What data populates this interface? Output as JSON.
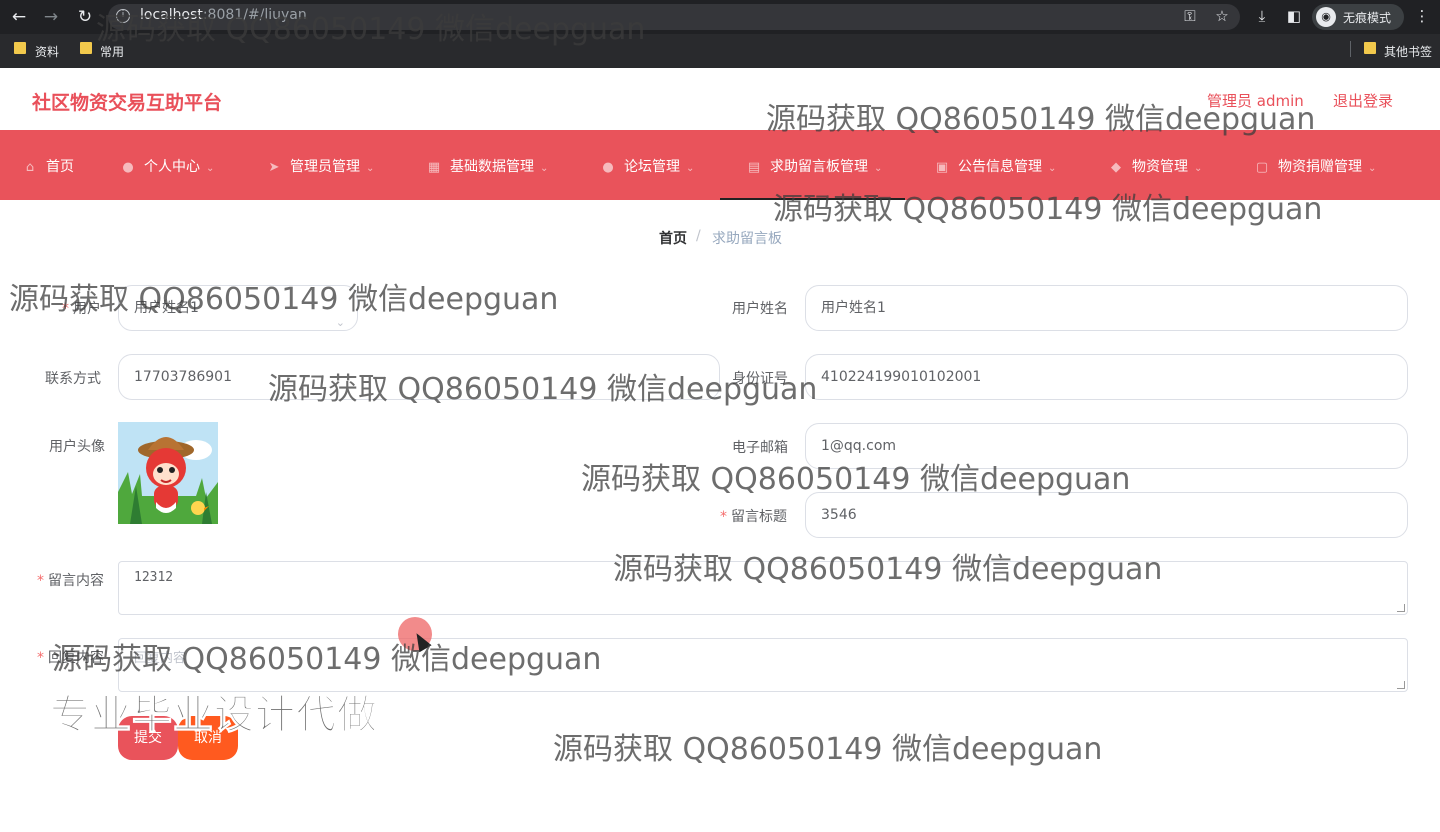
{
  "browser": {
    "url_host": "localhost",
    "url_rest": ":8081/#/liuyan",
    "incognito_label": "无痕模式",
    "bookmarks": [
      "资料",
      "常用"
    ],
    "other_bookmarks": "其他书签"
  },
  "header": {
    "title": "社区物资交易互助平台",
    "admin_label": "管理员 admin",
    "logout_label": "退出登录"
  },
  "nav": {
    "items": [
      {
        "label": "首页",
        "icon": "home-icon"
      },
      {
        "label": "个人中心",
        "icon": "user-icon"
      },
      {
        "label": "管理员管理",
        "icon": "send-icon"
      },
      {
        "label": "基础数据管理",
        "icon": "grid-icon"
      },
      {
        "label": "论坛管理",
        "icon": "user-icon"
      },
      {
        "label": "求助留言板管理",
        "icon": "calendar-icon"
      },
      {
        "label": "公告信息管理",
        "icon": "briefcase-icon"
      },
      {
        "label": "物资管理",
        "icon": "map-pin-icon"
      },
      {
        "label": "物资捐赠管理",
        "icon": "box-icon"
      }
    ],
    "active_index": 5
  },
  "breadcrumb": {
    "home": "首页",
    "separator": "/",
    "current": "求助留言板"
  },
  "form": {
    "user_label": "用户",
    "user_value": "用户姓名1",
    "username_label": "用户姓名",
    "username_value": "用户姓名1",
    "phone_label": "联系方式",
    "phone_value": "17703786901",
    "idcard_label": "身份证号",
    "idcard_value": "410224199010102001",
    "avatar_label": "用户头像",
    "email_label": "电子邮箱",
    "email_value": "1@qq.com",
    "title_label": "留言标题",
    "title_value": "3546",
    "content_label": "留言内容",
    "content_value": "12312",
    "reply_label": "回复内容",
    "reply_placeholder": "回复内容",
    "submit_label": "提交",
    "cancel_label": "取消"
  },
  "overlays": {
    "watermark": "源码获取 QQ86050149 微信deepguan",
    "promo": "专业毕业设计代做"
  },
  "colors": {
    "brand": "#e9535b",
    "cancel": "#ff5a1f",
    "browser_dark": "#202124"
  }
}
